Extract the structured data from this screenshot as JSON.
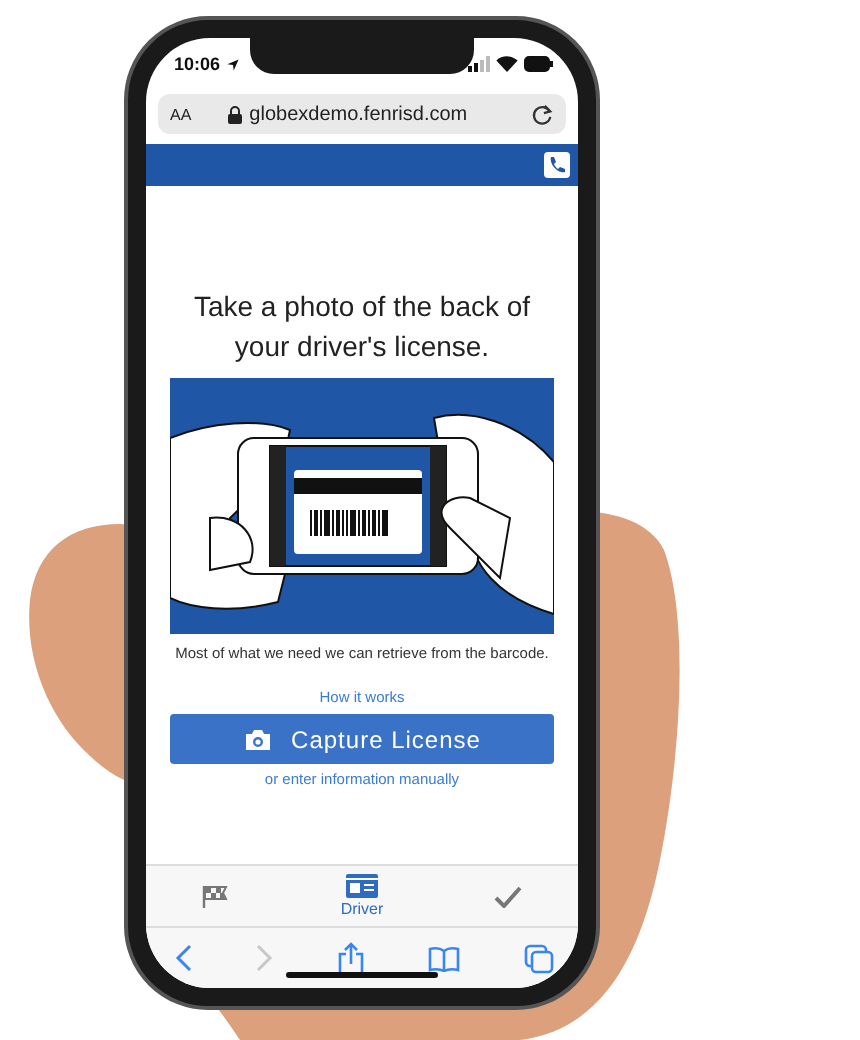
{
  "status_bar": {
    "time": "10:06"
  },
  "browser": {
    "text_size_button": "AA",
    "url": "globexdemo.fenrisd.com"
  },
  "page": {
    "title": "Take a photo of the back of your driver's license.",
    "caption": "Most of what we need we can retrieve from the barcode.",
    "help_link": "How it works",
    "capture_button": "Capture License",
    "manual_link": "or enter information manually"
  },
  "steps": [
    {
      "kind": "flag",
      "selected": false
    },
    {
      "kind": "driver",
      "label": "Driver",
      "selected": true
    },
    {
      "kind": "check",
      "selected": false
    }
  ],
  "toolbar": [
    {
      "kind": "back",
      "disabled": false
    },
    {
      "kind": "forward",
      "disabled": true
    },
    {
      "kind": "share",
      "disabled": false
    },
    {
      "kind": "bookmarks",
      "disabled": false
    },
    {
      "kind": "tabs",
      "disabled": false
    }
  ]
}
